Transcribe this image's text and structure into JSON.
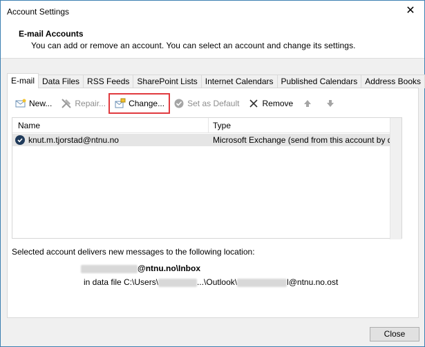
{
  "window": {
    "title": "Account Settings",
    "close_glyph": "✕"
  },
  "header": {
    "title": "E-mail Accounts",
    "description": "You can add or remove an account. You can select an account and change its settings."
  },
  "tabs": [
    {
      "label": "E-mail",
      "active": true
    },
    {
      "label": "Data Files"
    },
    {
      "label": "RSS Feeds"
    },
    {
      "label": "SharePoint Lists"
    },
    {
      "label": "Internet Calendars"
    },
    {
      "label": "Published Calendars"
    },
    {
      "label": "Address Books"
    }
  ],
  "toolbar": {
    "new_label": "New...",
    "repair_label": "Repair...",
    "change_label": "Change...",
    "set_default_label": "Set as Default",
    "remove_label": "Remove",
    "highlight_color": "#e0393e"
  },
  "accounts": {
    "columns": {
      "name": "Name",
      "type": "Type"
    },
    "rows": [
      {
        "name": "knut.m.tjorstad@ntnu.no",
        "type": "Microsoft Exchange (send from this account by def..."
      }
    ]
  },
  "delivery": {
    "intro": "Selected account delivers new messages to the following location:",
    "mailbox_suffix": "@ntnu.no\\Inbox",
    "file_prefix": "in data file C:\\Users\\",
    "file_middle": "...\\Outlook\\",
    "file_suffix": "l@ntnu.no.ost"
  },
  "footer": {
    "close_label": "Close"
  }
}
